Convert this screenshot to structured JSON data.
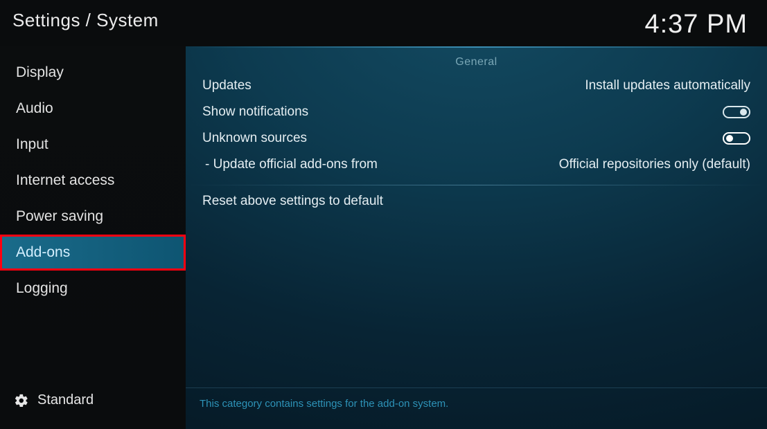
{
  "header": {
    "breadcrumb": "Settings / System",
    "clock": "4:37 PM"
  },
  "sidebar": {
    "items": [
      {
        "label": "Display"
      },
      {
        "label": "Audio"
      },
      {
        "label": "Input"
      },
      {
        "label": "Internet access"
      },
      {
        "label": "Power saving"
      },
      {
        "label": "Add-ons"
      },
      {
        "label": "Logging"
      }
    ],
    "selected_index": 5,
    "highlight_index": 5,
    "level_label": "Standard"
  },
  "content": {
    "group_title": "General",
    "settings": [
      {
        "label": "Updates",
        "value": "Install updates automatically",
        "type": "select"
      },
      {
        "label": "Show notifications",
        "type": "toggle",
        "on": false
      },
      {
        "label": "Unknown sources",
        "type": "toggle",
        "on": true
      },
      {
        "label": "- Update official add-ons from",
        "value": "Official repositories only (default)",
        "type": "select",
        "sub": true
      }
    ],
    "reset_label": "Reset above settings to default",
    "description": "This category contains settings for the add-on system."
  }
}
